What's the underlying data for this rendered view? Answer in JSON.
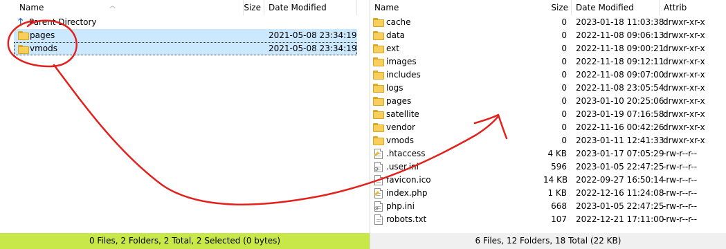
{
  "left": {
    "columns": {
      "name": "Name",
      "size": "Size",
      "modified": "Date Modified"
    },
    "parent": "Parent Directory",
    "rows": [
      {
        "name": "pages",
        "modified": "2021-05-08 23:34:19"
      },
      {
        "name": "vmods",
        "modified": "2021-05-08 23:34:19"
      }
    ],
    "status": "0 Files, 2 Folders, 2 Total, 2 Selected (0 bytes)",
    "status_color": "#c8e84a"
  },
  "right": {
    "columns": {
      "name": "Name",
      "size": "Size",
      "modified": "Date Modified",
      "attrib": "Attrib"
    },
    "rows": [
      {
        "type": "folder",
        "name": "cache",
        "size": "0",
        "modified": "2023-01-18 11:03:38",
        "attrib": "drwxr-xr-x"
      },
      {
        "type": "folder",
        "name": "data",
        "size": "0",
        "modified": "2022-11-08 09:06:13",
        "attrib": "drwxr-xr-x"
      },
      {
        "type": "folder",
        "name": "ext",
        "size": "0",
        "modified": "2022-11-18 09:00:21",
        "attrib": "drwxr-xr-x"
      },
      {
        "type": "folder",
        "name": "images",
        "size": "0",
        "modified": "2022-11-18 09:12:11",
        "attrib": "drwxr-xr-x"
      },
      {
        "type": "folder",
        "name": "includes",
        "size": "0",
        "modified": "2022-11-08 09:07:00",
        "attrib": "drwxr-xr-x"
      },
      {
        "type": "folder",
        "name": "logs",
        "size": "0",
        "modified": "2022-11-08 23:05:54",
        "attrib": "drwxr-xr-x"
      },
      {
        "type": "folder",
        "name": "pages",
        "size": "0",
        "modified": "2023-01-10 20:25:06",
        "attrib": "drwxr-xr-x"
      },
      {
        "type": "folder",
        "name": "satellite",
        "size": "0",
        "modified": "2023-01-19 07:16:58",
        "attrib": "drwxr-xr-x"
      },
      {
        "type": "folder",
        "name": "vendor",
        "size": "0",
        "modified": "2022-11-16 00:42:26",
        "attrib": "drwxr-xr-x"
      },
      {
        "type": "folder",
        "name": "vmods",
        "size": "0",
        "modified": "2023-01-11 12:41:33",
        "attrib": "drwxr-xr-x"
      },
      {
        "type": "file-edit",
        "name": ".htaccess",
        "size": "4 KB",
        "modified": "2023-01-17 07:05:29",
        "attrib": "-rw-r--r--"
      },
      {
        "type": "file-config",
        "name": ".user.ini",
        "size": "596",
        "modified": "2023-01-05 22:47:25",
        "attrib": "-rw-r--r--"
      },
      {
        "type": "file-plain",
        "name": "favicon.ico",
        "size": "14 KB",
        "modified": "2022-09-27 16:50:14",
        "attrib": "-rw-r--r--"
      },
      {
        "type": "file-edit",
        "name": "index.php",
        "size": "1 KB",
        "modified": "2022-12-16 11:24:08",
        "attrib": "-rw-r--r--"
      },
      {
        "type": "file-config",
        "name": "php.ini",
        "size": "668",
        "modified": "2023-01-05 22:47:25",
        "attrib": "-rw-r--r--"
      },
      {
        "type": "file-plain",
        "name": "robots.txt",
        "size": "107",
        "modified": "2022-12-21 17:11:00",
        "attrib": "-rw-r--r--"
      }
    ],
    "status": "6 Files, 12 Folders, 18 Total (22 KB)"
  },
  "annotation_color": "#e3201c"
}
